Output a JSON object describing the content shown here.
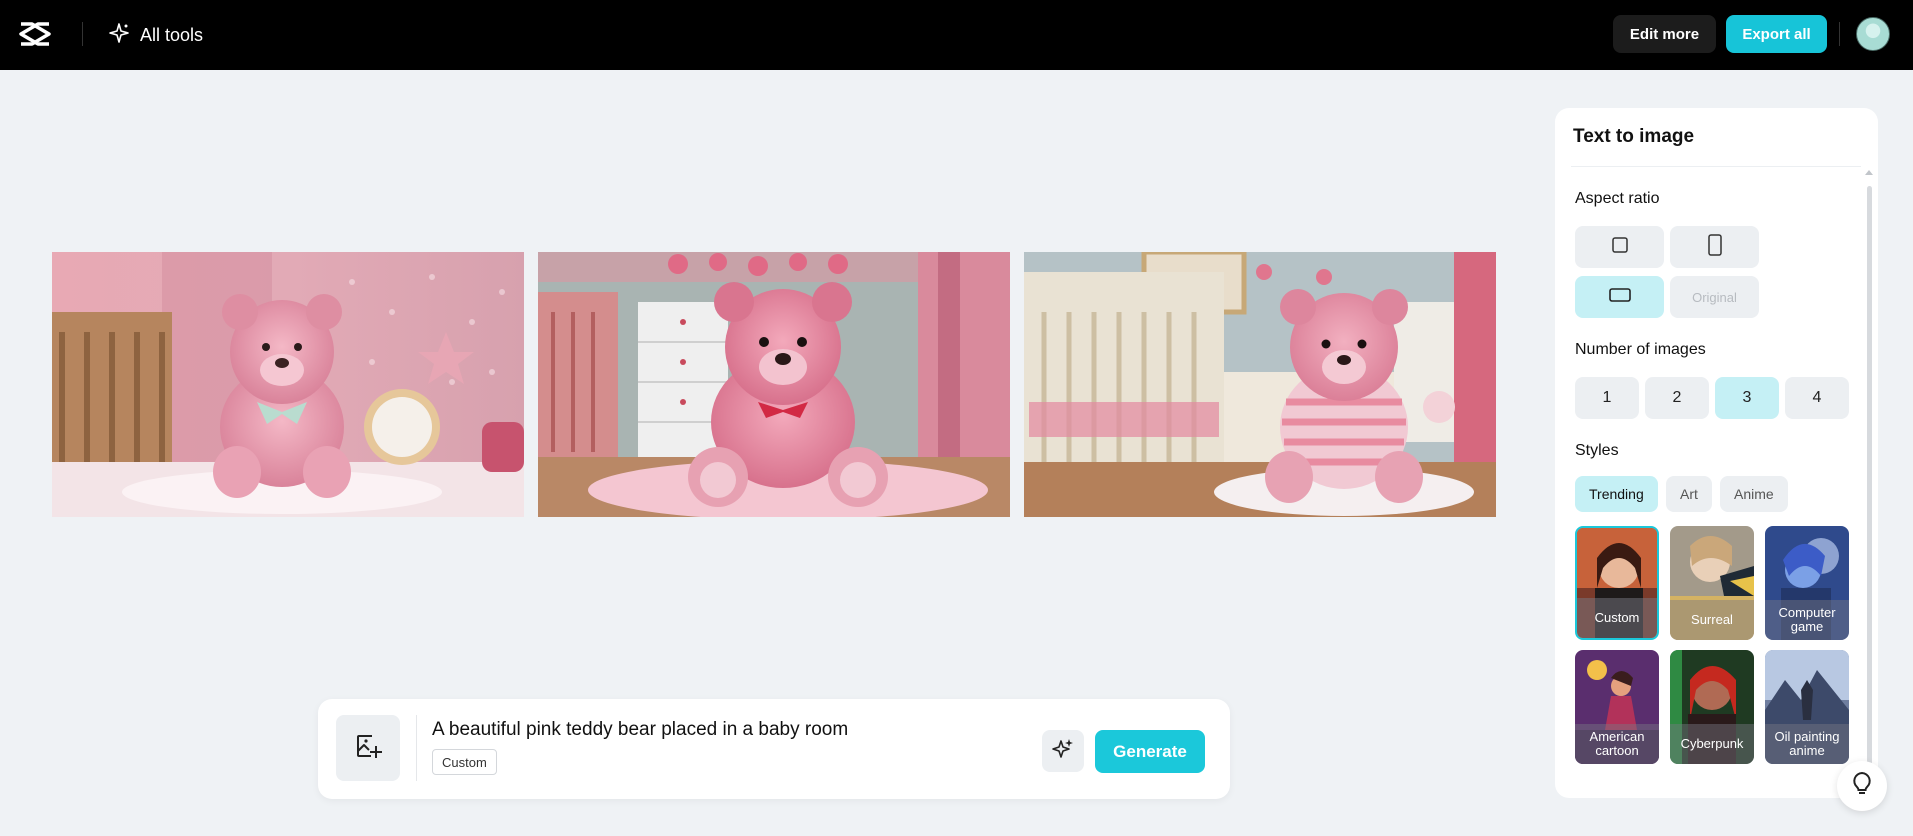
{
  "topbar": {
    "all_tools_label": "All tools",
    "edit_more_label": "Edit more",
    "export_all_label": "Export all"
  },
  "gallery": {
    "images": [
      {
        "name": "generated-image-1",
        "desc": "pink teddy bear by crib with clock"
      },
      {
        "name": "generated-image-2",
        "desc": "pink teddy bear with red bow"
      },
      {
        "name": "generated-image-3",
        "desc": "pink teddy bear in striped outfit by crib"
      }
    ]
  },
  "prompt": {
    "text": "A beautiful pink teddy bear placed in a baby room",
    "style_tag": "Custom",
    "generate_label": "Generate"
  },
  "panel": {
    "title": "Text to image",
    "aspect_ratio_label": "Aspect ratio",
    "aspect_options": [
      "square",
      "portrait",
      "landscape",
      "Original"
    ],
    "aspect_selected": "landscape",
    "num_images_label": "Number of images",
    "num_options": [
      "1",
      "2",
      "3",
      "4"
    ],
    "num_selected": "3",
    "styles_label": "Styles",
    "style_tabs": [
      "Trending",
      "Art",
      "Anime"
    ],
    "style_tab_selected": "Trending",
    "style_cards": [
      {
        "label": "Custom"
      },
      {
        "label": "Surreal"
      },
      {
        "label": "Computer game"
      },
      {
        "label": "American cartoon"
      },
      {
        "label": "Cyberpunk"
      },
      {
        "label": "Oil painting anime"
      }
    ],
    "style_selected": "Custom"
  },
  "colors": {
    "accent": "#1bc8da",
    "accent_light": "#c5f0f5",
    "topbar_bg": "#000000",
    "page_bg": "#eff2f5"
  }
}
